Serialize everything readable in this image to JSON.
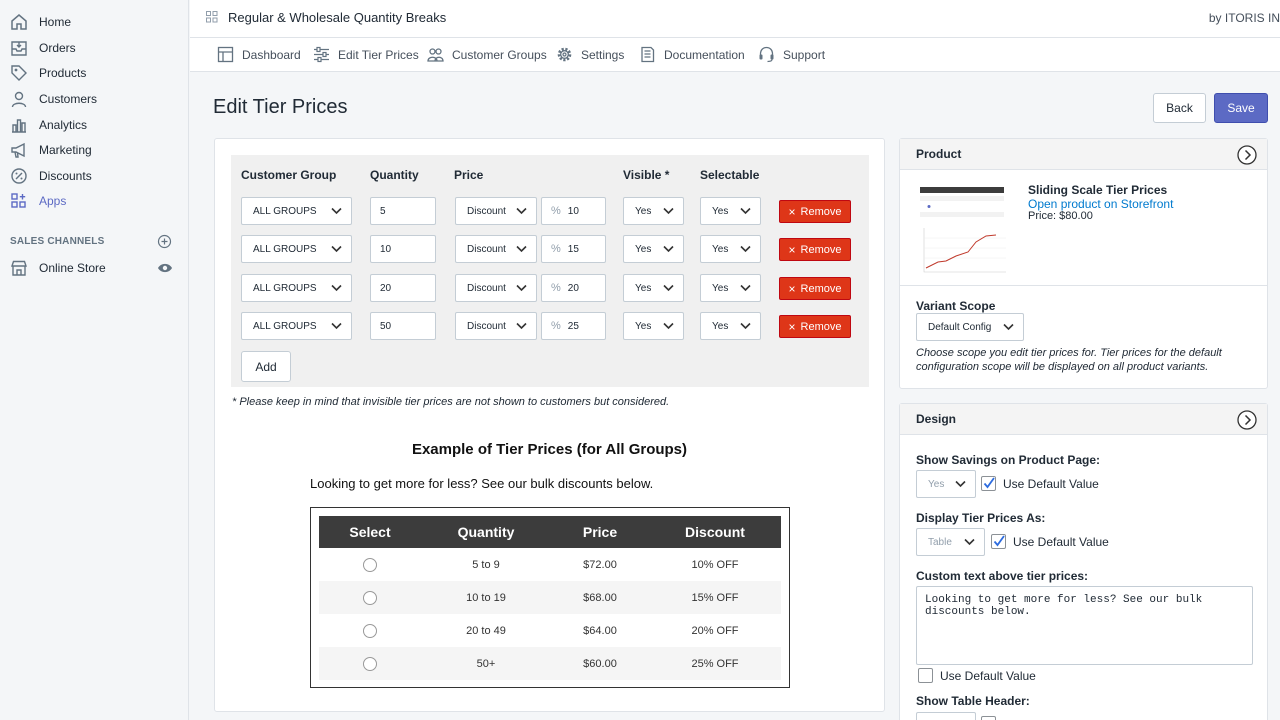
{
  "sidebar": {
    "items": [
      {
        "label": "Home",
        "icon": "home-icon"
      },
      {
        "label": "Orders",
        "icon": "orders-icon"
      },
      {
        "label": "Products",
        "icon": "tag-icon"
      },
      {
        "label": "Customers",
        "icon": "person-icon"
      },
      {
        "label": "Analytics",
        "icon": "bar-chart-icon"
      },
      {
        "label": "Marketing",
        "icon": "megaphone-icon"
      },
      {
        "label": "Discounts",
        "icon": "discount-icon"
      },
      {
        "label": "Apps",
        "icon": "apps-icon"
      }
    ],
    "sales_channels_label": "SALES CHANNELS",
    "online_store_label": "Online Store"
  },
  "topbar": {
    "title": "Regular & Wholesale Quantity Breaks",
    "by": "by ITORIS IN"
  },
  "tabs": [
    {
      "label": "Dashboard",
      "icon": "dashboard-icon"
    },
    {
      "label": "Edit Tier Prices",
      "icon": "sliders-icon"
    },
    {
      "label": "Customer Groups",
      "icon": "people-icon"
    },
    {
      "label": "Settings",
      "icon": "gear-icon"
    },
    {
      "label": "Documentation",
      "icon": "document-icon"
    },
    {
      "label": "Support",
      "icon": "headset-icon"
    }
  ],
  "page": {
    "title": "Edit Tier Prices",
    "back_label": "Back",
    "save_label": "Save"
  },
  "tier_table": {
    "headers": {
      "group": "Customer Group",
      "quantity": "Quantity",
      "price": "Price",
      "visible": "Visible *",
      "selectable": "Selectable"
    },
    "rows": [
      {
        "group": "ALL GROUPS",
        "quantity": "5",
        "price_type": "Discount",
        "percent_sign": "%",
        "percent": "10",
        "visible": "Yes",
        "selectable": "Yes",
        "remove": "Remove"
      },
      {
        "group": "ALL GROUPS",
        "quantity": "10",
        "price_type": "Discount",
        "percent_sign": "%",
        "percent": "15",
        "visible": "Yes",
        "selectable": "Yes",
        "remove": "Remove"
      },
      {
        "group": "ALL GROUPS",
        "quantity": "20",
        "price_type": "Discount",
        "percent_sign": "%",
        "percent": "20",
        "visible": "Yes",
        "selectable": "Yes",
        "remove": "Remove"
      },
      {
        "group": "ALL GROUPS",
        "quantity": "50",
        "price_type": "Discount",
        "percent_sign": "%",
        "percent": "25",
        "visible": "Yes",
        "selectable": "Yes",
        "remove": "Remove"
      }
    ],
    "add_label": "Add",
    "note": "* Please keep in mind that invisible tier prices are not shown to customers but considered."
  },
  "example": {
    "title": "Example of Tier Prices (for All Groups)",
    "text": "Looking to get more for less? See our bulk discounts below.",
    "headers": {
      "select": "Select",
      "quantity": "Quantity",
      "price": "Price",
      "discount": "Discount"
    },
    "rows": [
      {
        "quantity": "5 to 9",
        "price": "$72.00",
        "discount": "10% OFF"
      },
      {
        "quantity": "10 to 19",
        "price": "$68.00",
        "discount": "15% OFF"
      },
      {
        "quantity": "20 to 49",
        "price": "$64.00",
        "discount": "20% OFF"
      },
      {
        "quantity": "50+",
        "price": "$60.00",
        "discount": "25% OFF"
      }
    ]
  },
  "product_panel": {
    "title": "Product",
    "name": "Sliding Scale Tier Prices",
    "link": "Open product on Storefront",
    "price": "Price: $80.00",
    "variant_scope_label": "Variant Scope",
    "variant_scope_value": "Default Config",
    "description": "Choose scope you edit tier prices for. Tier prices for the default configuration scope will be displayed on all product variants."
  },
  "design_panel": {
    "title": "Design",
    "show_savings_label": "Show Savings on Product Page:",
    "show_savings_value": "Yes",
    "use_default_label": "Use Default Value",
    "display_as_label": "Display Tier Prices As:",
    "display_as_value": "Table",
    "custom_text_label": "Custom text above tier prices:",
    "custom_text_value": "Looking to get more for less? See our bulk discounts below.",
    "show_header_label": "Show Table Header:"
  },
  "colors": {
    "accent": "#5c6ac4",
    "remove": "#de3618",
    "link": "#007ace",
    "table_header": "#3c3c3c"
  }
}
